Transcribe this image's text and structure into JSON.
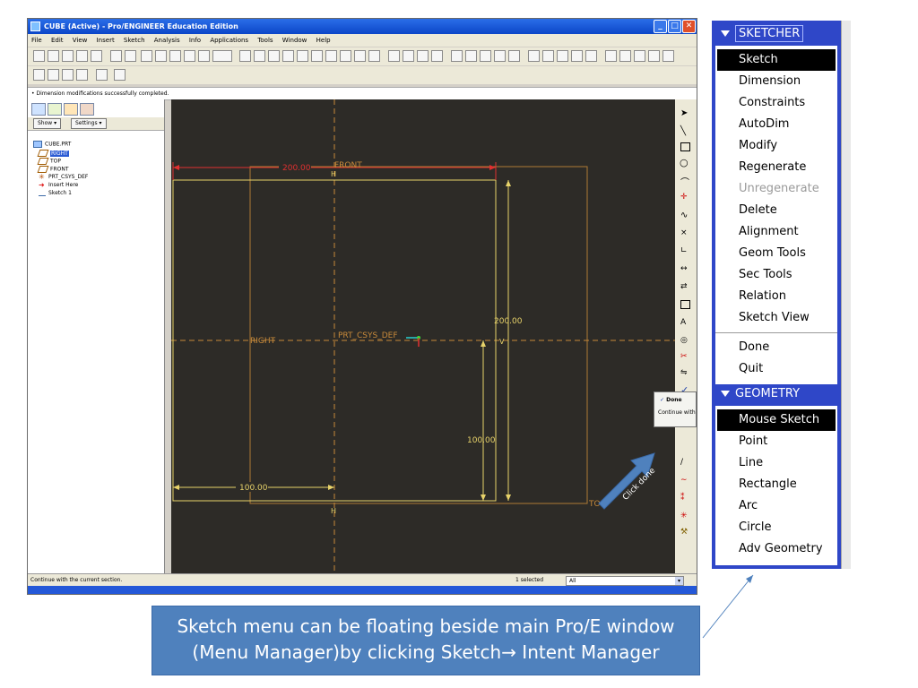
{
  "window": {
    "title": "CUBE (Active) - Pro/ENGINEER Education Edition",
    "menus": [
      "File",
      "Edit",
      "View",
      "Insert",
      "Sketch",
      "Analysis",
      "Info",
      "Applications",
      "Tools",
      "Window",
      "Help"
    ],
    "message": "• Dimension modifications successfully completed.",
    "status_left": "Continue with the current section.",
    "status_selected": "1 selected",
    "filter_value": "All"
  },
  "model_tree": {
    "show_label": "Show",
    "settings_label": "Settings",
    "items": [
      "CUBE.PRT",
      "RIGHT",
      "TOP",
      "FRONT",
      "PRT_CSYS_DEF",
      "Insert Here",
      "Sketch 1"
    ]
  },
  "sketch": {
    "dim_top": "200.00",
    "dim_right": "200.00",
    "dim_inner_vertical": "100.00",
    "dim_bottom": "100.00",
    "label_front": "FRONT",
    "label_right": "RIGHT",
    "label_top": "TOP",
    "label_csys": "PRT_CSYS_DEF",
    "h_marker": "H",
    "v_marker": "V"
  },
  "done_popup": {
    "done": "Done",
    "continue": "Continue with"
  },
  "callout_click": "Click done",
  "menu_manager": {
    "sketcher_title": "SKETCHER",
    "sketcher_items": [
      "Sketch",
      "Dimension",
      "Constraints",
      "AutoDim",
      "Modify",
      "Regenerate",
      "Unregenerate",
      "Delete",
      "Alignment",
      "Geom Tools",
      "Sec Tools",
      "Relation",
      "Sketch View"
    ],
    "done": "Done",
    "quit": "Quit",
    "geometry_title": "GEOMETRY",
    "geometry_items": [
      "Mouse Sketch",
      "Point",
      "Line",
      "Rectangle",
      "Arc",
      "Circle",
      "Adv Geometry"
    ]
  },
  "caption": {
    "line1": "Sketch menu can be floating beside main Pro/E window",
    "line2": "(Menu Manager)by clicking Sketch→ Intent Manager"
  },
  "colors": {
    "canvas": "#2d2b27",
    "sketch_yellow": "#e8d36a",
    "datum_orange": "#c88a3a",
    "dim_red": "#e03030",
    "menu_blue": "#2f47c8",
    "caption_blue": "#4f81bd"
  }
}
